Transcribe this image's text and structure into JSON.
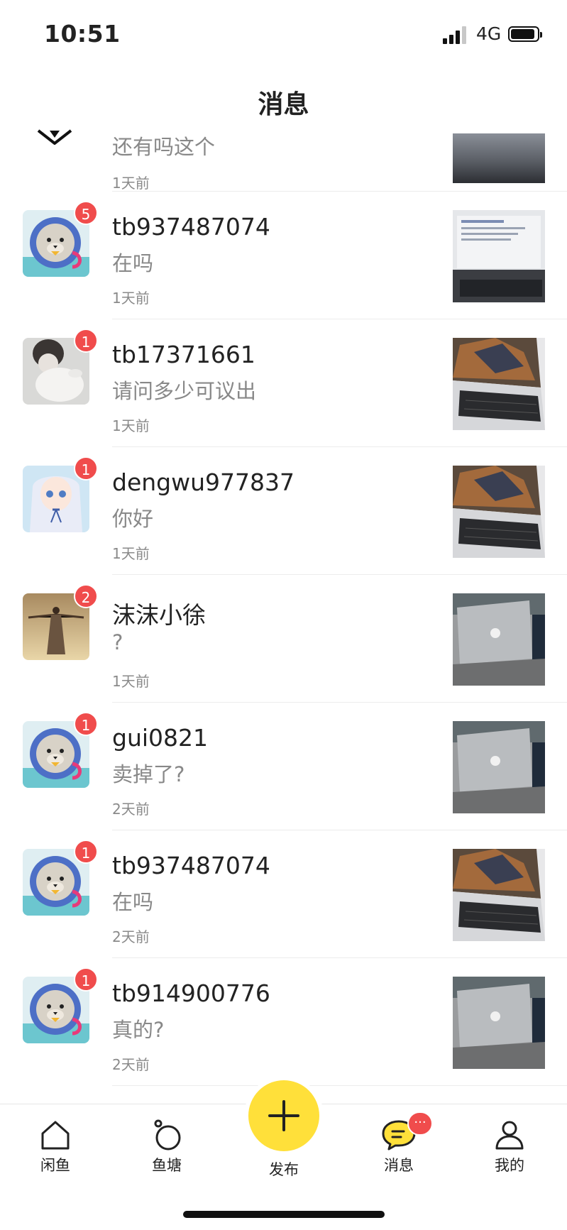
{
  "status": {
    "time": "10:51",
    "network": "4G"
  },
  "header": {
    "title": "消息"
  },
  "partial_row": {
    "message": "还有吗这个",
    "time": "1天前"
  },
  "conversations": [
    {
      "name": "tb937487074",
      "message": "在吗",
      "time": "1天前",
      "badge": "5",
      "avatar": "seal-astronaut",
      "thumb": "laptop-screen"
    },
    {
      "name": "tb17371661",
      "message": "请问多少可议出",
      "time": "1天前",
      "badge": "1",
      "avatar": "girl-with-rabbit",
      "thumb": "macbook-keyboard"
    },
    {
      "name": "dengwu977837",
      "message": "你好",
      "time": "1天前",
      "badge": "1",
      "avatar": "anime-girl",
      "thumb": "macbook-keyboard"
    },
    {
      "name": "沫沫小徐",
      "message": "?",
      "time": "1天前",
      "badge": "2",
      "avatar": "desert-figure",
      "thumb": "macbook-lid"
    },
    {
      "name": "gui0821",
      "message": "卖掉了?",
      "time": "2天前",
      "badge": "1",
      "avatar": "seal-astronaut",
      "thumb": "macbook-lid"
    },
    {
      "name": "tb937487074",
      "message": "在吗",
      "time": "2天前",
      "badge": "1",
      "avatar": "seal-astronaut",
      "thumb": "macbook-keyboard"
    },
    {
      "name": "tb914900776",
      "message": "真的?",
      "time": "2天前",
      "badge": "1",
      "avatar": "seal-astronaut",
      "thumb": "macbook-lid"
    }
  ],
  "tabbar": {
    "items": [
      {
        "label": "闲鱼",
        "icon": "home-icon"
      },
      {
        "label": "鱼塘",
        "icon": "pond-icon"
      },
      {
        "label": "发布",
        "icon": "plus-icon"
      },
      {
        "label": "消息",
        "icon": "chat-icon",
        "badge": "···"
      },
      {
        "label": "我的",
        "icon": "person-icon"
      }
    ]
  },
  "colors": {
    "accent": "#ffe03a",
    "badge": "#f04c4c"
  }
}
